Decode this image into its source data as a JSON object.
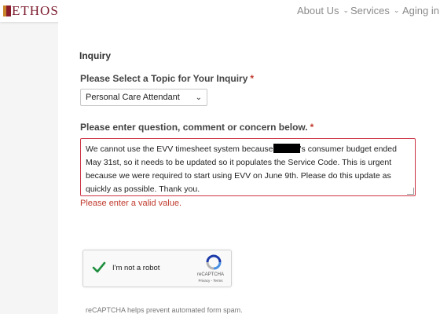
{
  "header": {
    "logo_text": "ETHOS",
    "nav": [
      {
        "label": "About Us"
      },
      {
        "label": "Services"
      },
      {
        "label": "Aging in C"
      }
    ]
  },
  "form": {
    "section_title": "Inquiry",
    "topic_label": "Please Select a Topic for Your Inquiry",
    "topic_required": "*",
    "topic_selected": "Personal Care Attendant",
    "question_label": "Please enter question, comment or concern below.",
    "question_required": "*",
    "question_text_before": "We cannot use the EVV timesheet system because",
    "question_text_after": "'s consumer budget ended May 31st, so it needs to be updated so it populates the Service Code.  This is urgent because we were required to start using EVV on June 9th. Please do this update as quickly as possible. Thank you.",
    "error_message": "Please enter a valid value."
  },
  "recaptcha": {
    "label": "I'm not a robot",
    "brand": "reCAPTCHA",
    "links": "Privacy - Terms",
    "note": "reCAPTCHA helps prevent automated form spam."
  },
  "colors": {
    "brand": "#7b1a2c",
    "error": "#c0392b",
    "check": "#1e8e3e"
  }
}
